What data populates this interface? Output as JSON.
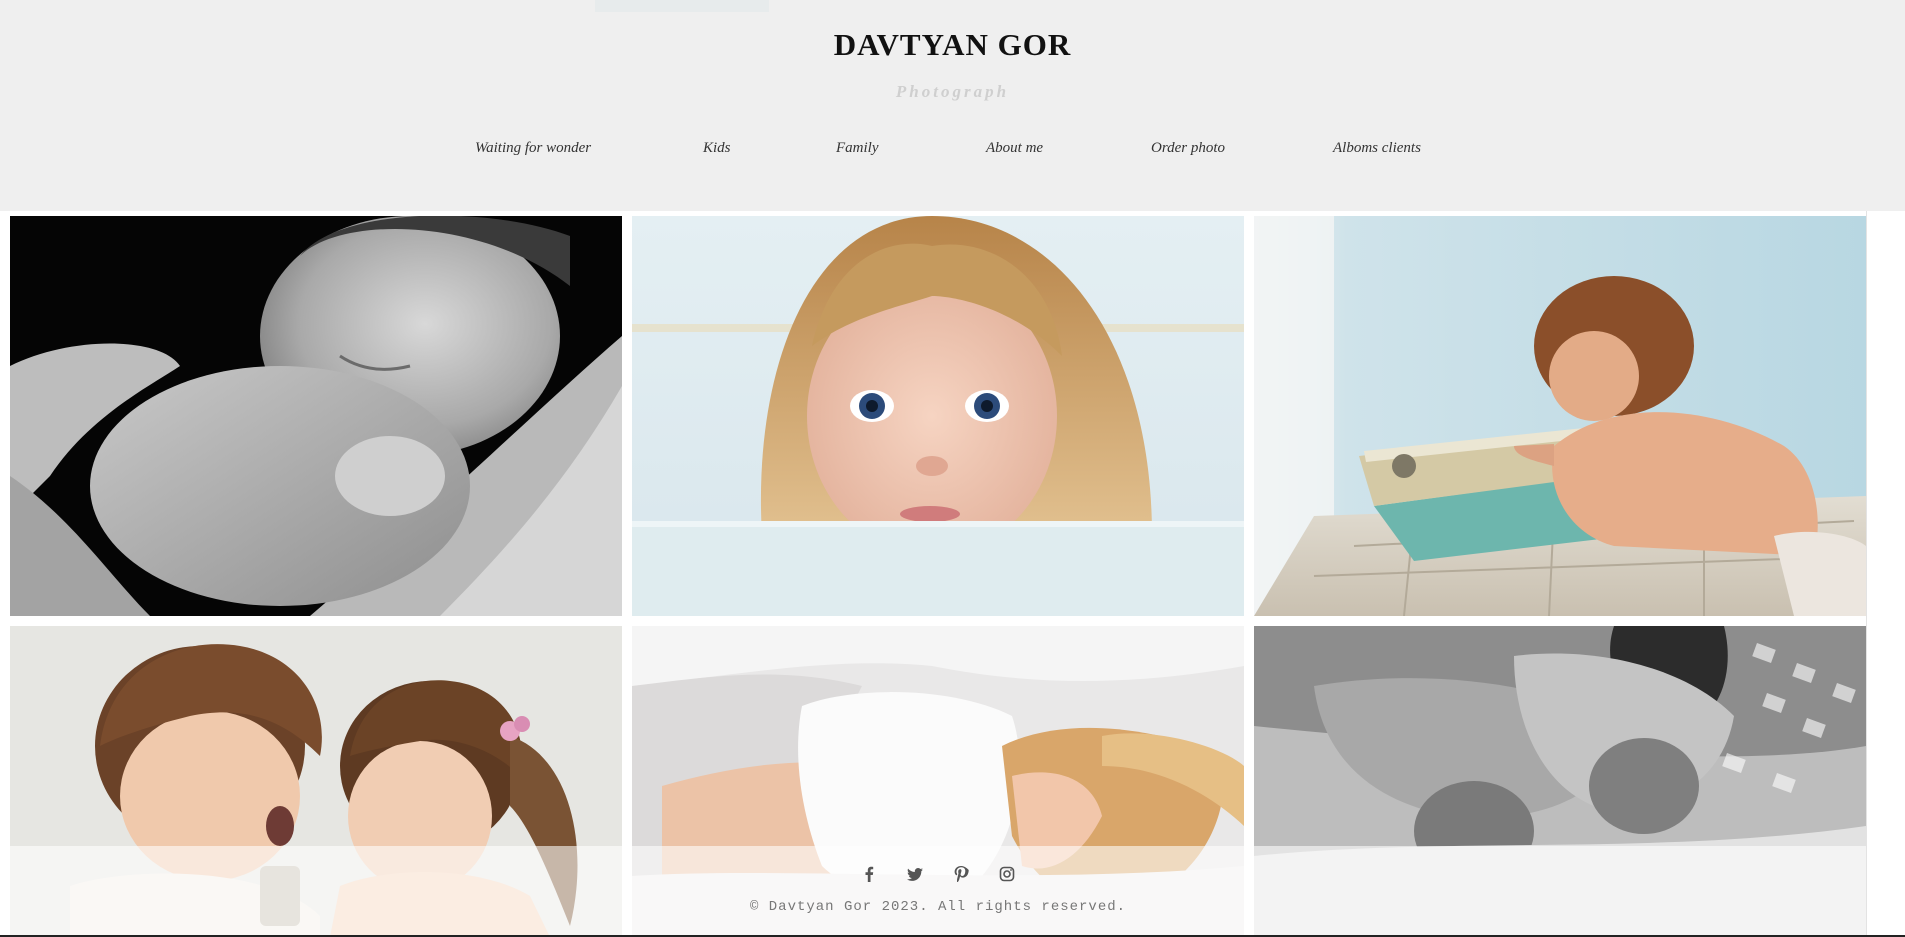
{
  "header": {
    "title": "DAVTYAN GOR",
    "subtitle": "Photograph",
    "background": "#efefef"
  },
  "nav": {
    "items": [
      {
        "label": "Waiting for wonder"
      },
      {
        "label": "Kids"
      },
      {
        "label": "Family"
      },
      {
        "label": "About me"
      },
      {
        "label": "Order photo"
      },
      {
        "label": "Alboms clients"
      }
    ]
  },
  "gallery": {
    "photos": [
      {
        "subject": "sleeping newborn, black and white"
      },
      {
        "subject": "blonde girl with blue eyes"
      },
      {
        "subject": "boy at vintage typewriter"
      },
      {
        "subject": "two children facing each other"
      },
      {
        "subject": "mother lying in white top"
      },
      {
        "subject": "two children sleeping in bed"
      }
    ]
  },
  "footer": {
    "social_icons": [
      "facebook-icon",
      "twitter-icon",
      "pinterest-icon",
      "instagram-icon"
    ],
    "copyright": "© Davtyan Gor 2023. All rights reserved."
  }
}
